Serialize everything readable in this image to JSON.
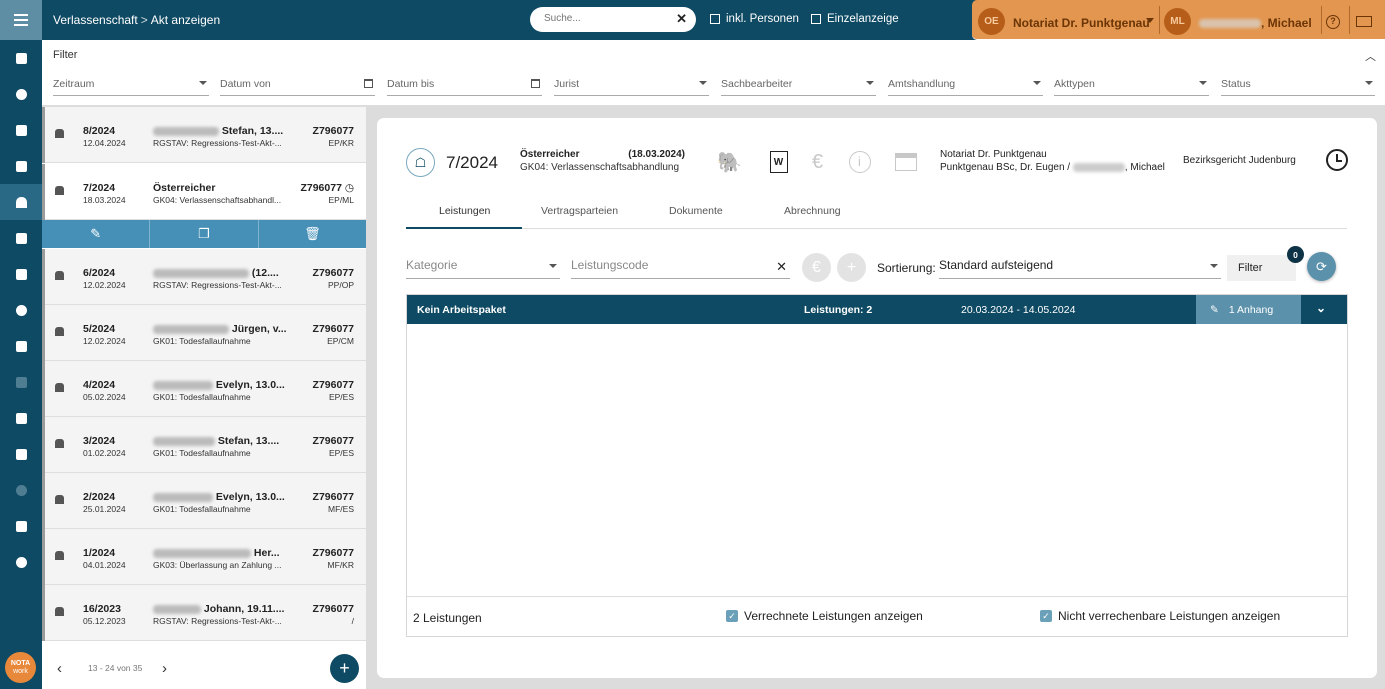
{
  "app": {
    "logo": [
      "NOTA",
      "work"
    ]
  },
  "rail": {
    "icons": [
      "calendar-check-icon",
      "person-icon",
      "list-icon",
      "books-icon",
      "estate-icon",
      "document-icon",
      "bank-icon",
      "euro-icon",
      "copy-icon",
      "square-icon",
      "file-text-icon",
      "timeline-icon",
      "info-icon",
      "chart-icon",
      "gear-icon"
    ]
  },
  "topbar": {
    "breadcrumb": [
      "Verlassenschaft",
      "Akt anzeigen"
    ],
    "breadcrumb_sep": ">",
    "search_placeholder": "Suche...",
    "check_persons": "inkl. Personen",
    "check_single": "Einzelanzeige",
    "org_initials": "OE",
    "org_name": "Notariat Dr. Punktgenau",
    "user_initials": "ML",
    "user_name": ", Michael"
  },
  "filter": {
    "title": "Filter",
    "fields": [
      "Zeitraum",
      "Datum von",
      "Datum bis",
      "Jurist",
      "Sachbearbeiter",
      "Amtshandlung",
      "Akttypen",
      "Status"
    ]
  },
  "list": {
    "items": [
      {
        "num": "8/2024",
        "date": "12.04.2024",
        "name": "Stefan, 13....",
        "desc": "RGSTAV: Regressions-Test-Akt-...",
        "code": "Z796077",
        "sub": "EP/KR"
      },
      {
        "num": "7/2024",
        "date": "18.03.2024",
        "name": "Österreicher",
        "desc": "GK04: Verlassenschaftsabhandl...",
        "code": "Z796077",
        "sub": "EP/ML",
        "selected": true
      },
      {
        "num": "6/2024",
        "date": "12.02.2024",
        "name": "(12....",
        "desc": "RGSTAV: Regressions-Test-Akt-...",
        "code": "Z796077",
        "sub": "PP/OP"
      },
      {
        "num": "5/2024",
        "date": "12.02.2024",
        "name": "Jürgen, v...",
        "desc": "GK01: Todesfallaufnahme",
        "code": "Z796077",
        "sub": "EP/CM"
      },
      {
        "num": "4/2024",
        "date": "05.02.2024",
        "name": "Evelyn, 13.0...",
        "desc": "GK01: Todesfallaufnahme",
        "code": "Z796077",
        "sub": "EP/ES"
      },
      {
        "num": "3/2024",
        "date": "01.02.2024",
        "name": "Stefan, 13....",
        "desc": "GK01: Todesfallaufnahme",
        "code": "Z796077",
        "sub": "EP/ES"
      },
      {
        "num": "2/2024",
        "date": "25.01.2024",
        "name": "Evelyn, 13.0...",
        "desc": "GK01: Todesfallaufnahme",
        "code": "Z796077",
        "sub": "MF/ES"
      },
      {
        "num": "1/2024",
        "date": "04.01.2024",
        "name": "Her...",
        "desc": "GK03: Überlassung an Zahlung ...",
        "code": "Z796077",
        "sub": "MF/KR"
      },
      {
        "num": "16/2023",
        "date": "05.12.2023",
        "name": "Johann, 19.11....",
        "desc": "RGSTAV: Regressions-Test-Akt-...",
        "code": "Z796077",
        "sub": "/"
      }
    ],
    "pager": "13 - 24 von 35"
  },
  "detail": {
    "number": "7/2024",
    "title": "Österreicher",
    "title_date": "(18.03.2024)",
    "subtitle": "GK04: Verlassenschaftsabhandlung",
    "notary_line1": "Notariat Dr. Punktgenau",
    "notary_line2_a": "Punktgenau BSc, Dr. Eugen /",
    "notary_line2_b": ", Michael",
    "court": "Bezirksgericht Judenburg",
    "tabs": [
      "Leistungen",
      "Vertragsparteien",
      "Dokumente",
      "Abrechnung"
    ],
    "category_placeholder": "Kategorie",
    "code_placeholder": "Leistungscode",
    "sort_label": "Sortierung:",
    "sort_value": "Standard aufsteigend",
    "filter_button": "Filter",
    "filter_count": "0",
    "group": {
      "name": "Kein Arbeitspaket",
      "count": "Leistungen: 2",
      "range": "20.03.2024 - 14.05.2024",
      "attachments": "1 Anhang"
    },
    "footer": {
      "count": "2 Leistungen",
      "check1": "Verrechnete Leistungen anzeigen",
      "check2": "Nicht verrechenbare Leistungen anzeigen"
    }
  }
}
